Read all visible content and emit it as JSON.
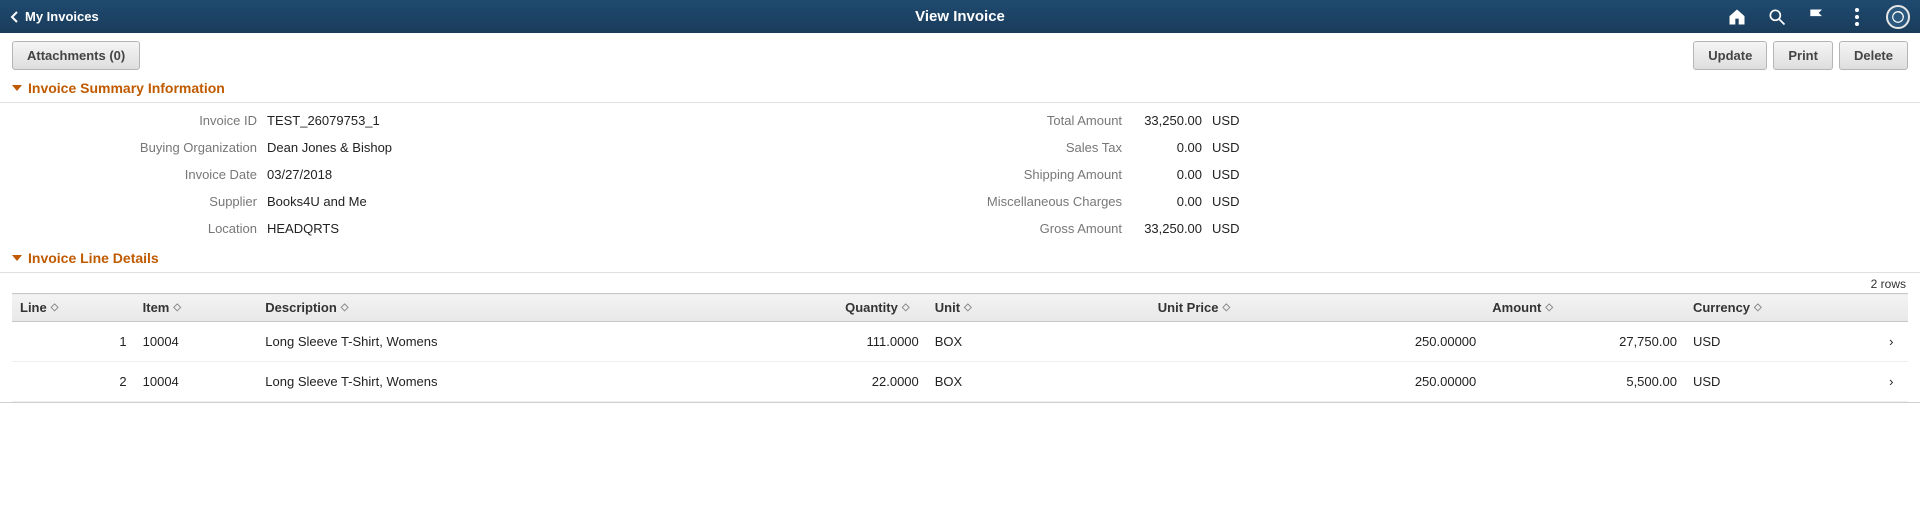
{
  "banner": {
    "back_label": "My Invoices",
    "title": "View Invoice"
  },
  "actions": {
    "attachments_label": "Attachments (0)",
    "update_label": "Update",
    "print_label": "Print",
    "delete_label": "Delete"
  },
  "sections": {
    "summary": "Invoice Summary Information",
    "lines": "Invoice Line Details"
  },
  "summary": {
    "labels": {
      "invoice_id": "Invoice ID",
      "buying_org": "Buying Organization",
      "invoice_date": "Invoice Date",
      "supplier": "Supplier",
      "location": "Location",
      "total_amount": "Total Amount",
      "sales_tax": "Sales Tax",
      "shipping_amount": "Shipping Amount",
      "misc_charges": "Miscellaneous Charges",
      "gross_amount": "Gross Amount"
    },
    "values": {
      "invoice_id": "TEST_26079753_1",
      "buying_org": "Dean Jones & Bishop",
      "invoice_date": "03/27/2018",
      "supplier": "Books4U and Me",
      "location": "HEADQRTS",
      "total_amount": "33,250.00",
      "sales_tax": "0.00",
      "shipping_amount": "0.00",
      "misc_charges": "0.00",
      "gross_amount": "33,250.00"
    },
    "currency": "USD"
  },
  "grid": {
    "row_count_label": "2 rows",
    "headers": {
      "line": "Line",
      "item": "Item",
      "description": "Description",
      "quantity": "Quantity",
      "unit": "Unit",
      "unit_price": "Unit Price",
      "amount": "Amount",
      "currency": "Currency"
    },
    "rows": [
      {
        "line": "1",
        "item": "10004",
        "description": "Long Sleeve T-Shirt, Womens",
        "quantity": "111.0000",
        "unit": "BOX",
        "unit_price": "250.00000",
        "amount": "27,750.00",
        "currency": "USD"
      },
      {
        "line": "2",
        "item": "10004",
        "description": "Long Sleeve T-Shirt, Womens",
        "quantity": "22.0000",
        "unit": "BOX",
        "unit_price": "250.00000",
        "amount": "5,500.00",
        "currency": "USD"
      }
    ]
  }
}
